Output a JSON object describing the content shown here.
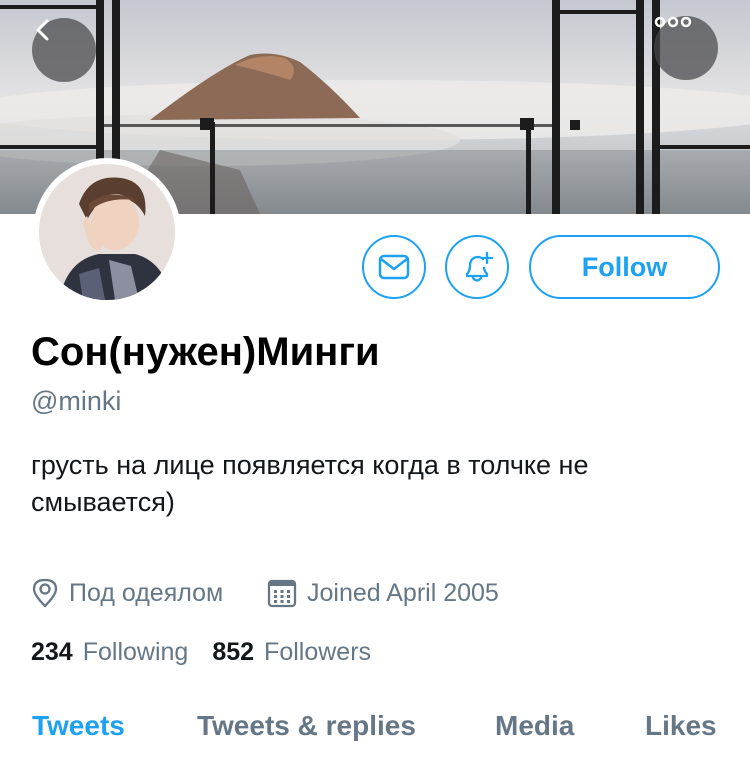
{
  "header": {
    "back_icon": "chevron-left-icon",
    "more_icon": "more-horizontal-icon"
  },
  "profile": {
    "display_name": "Сон(нужен)Минги",
    "handle": "@minki",
    "bio": "грусть на лице появляется когда в толчке не смывается)",
    "location": "Под одеялом",
    "joined": "Joined April 2005",
    "following_count": "234",
    "following_label": "Following",
    "followers_count": "852",
    "followers_label": "Followers"
  },
  "actions": {
    "message_icon": "mail-icon",
    "notify_icon": "bell-plus-icon",
    "follow_label": "Follow"
  },
  "tabs": [
    {
      "label": "Tweets",
      "active": true
    },
    {
      "label": "Tweets & replies",
      "active": false
    },
    {
      "label": "Media",
      "active": false
    },
    {
      "label": "Likes",
      "active": false
    }
  ],
  "colors": {
    "accent": "#1da1f2",
    "secondary_text": "#657786",
    "primary_text": "#14171a"
  }
}
